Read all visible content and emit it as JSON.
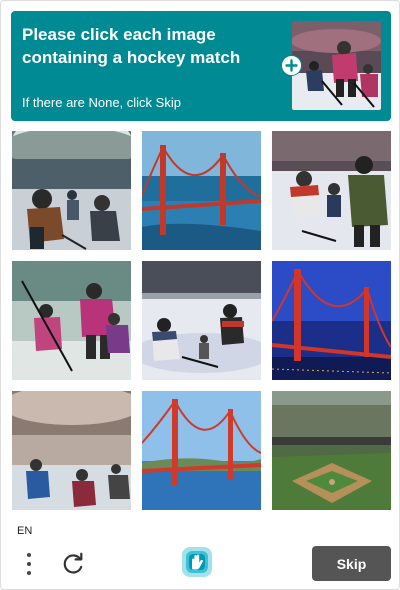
{
  "header": {
    "prompt": "Please click each image containing a hockey match",
    "subtext": "If there are None, click Skip",
    "sample_image": "hockey-match-sample",
    "expand_icon": "plus-circle-icon"
  },
  "grid": {
    "tiles": [
      {
        "subject": "hockey-arena-players"
      },
      {
        "subject": "golden-gate-bridge"
      },
      {
        "subject": "hockey-players-on-ice"
      },
      {
        "subject": "hockey-players-pink-jerseys"
      },
      {
        "subject": "hockey-players-rink"
      },
      {
        "subject": "golden-gate-bridge-night"
      },
      {
        "subject": "hockey-arena-blurred"
      },
      {
        "subject": "golden-gate-bridge-bay"
      },
      {
        "subject": "baseball-stadium"
      }
    ]
  },
  "footer": {
    "language": "EN",
    "menu_icon": "more-vertical-icon",
    "refresh_icon": "refresh-icon",
    "logo_icon": "hcaptcha-logo-icon",
    "skip_label": "Skip"
  },
  "colors": {
    "banner": "#008a94",
    "skip_button": "#555555"
  }
}
